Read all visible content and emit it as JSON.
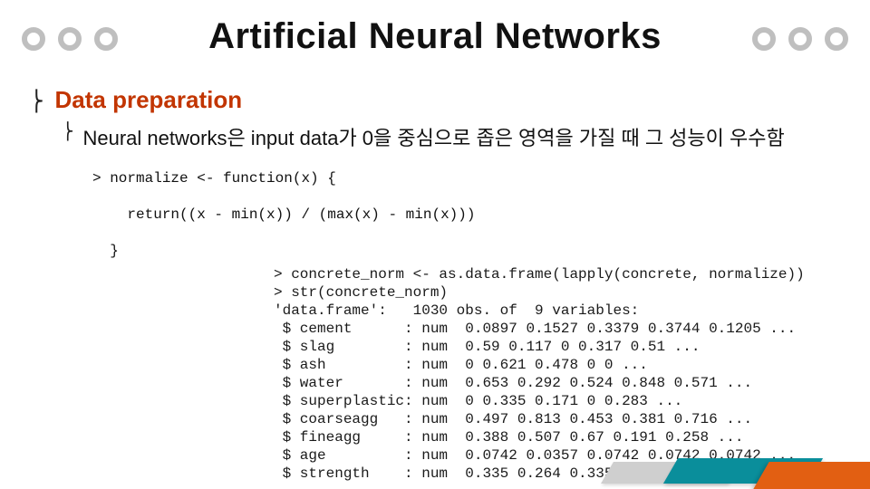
{
  "title": "Artificial Neural Networks",
  "section_heading": "Data preparation",
  "subpoint": "Neural networks은 input data가 0을 중심으로 좁은 영역을 가질 때 그 성능이 우수함",
  "code_block": "> normalize <- function(x) {\n\n    return((x - min(x)) / (max(x) - min(x)))\n\n  }",
  "r_output_intro": "> concrete_norm <- as.data.frame(lapply(concrete, normalize))\n> str(concrete_norm)\n'data.frame':   1030 obs. of  9 variables:",
  "r_vars": [
    {
      "name": "cement",
      "type": "num",
      "values": "0.0897 0.1527 0.3379 0.3744 0.1205 ..."
    },
    {
      "name": "slag",
      "type": "num",
      "values": "0.59 0.117 0 0.317 0.51 ..."
    },
    {
      "name": "ash",
      "type": "num",
      "values": "0 0.621 0.478 0 0 ..."
    },
    {
      "name": "water",
      "type": "num",
      "values": "0.653 0.292 0.524 0.848 0.571 ..."
    },
    {
      "name": "superplastic",
      "type": "num",
      "values": "0 0.335 0.171 0 0.283 ..."
    },
    {
      "name": "coarseagg",
      "type": "num",
      "values": "0.497 0.813 0.453 0.381 0.716 ..."
    },
    {
      "name": "fineagg",
      "type": "num",
      "values": "0.388 0.507 0.67 0.191 0.258 ..."
    },
    {
      "name": "age",
      "type": "num",
      "values": "0.0742 0.0357 0.0742 0.0742 0.0742 ..."
    },
    {
      "name": "strength",
      "type": "num",
      "values": "0.335 0.264 0.335 0.542 0.199 ..."
    }
  ]
}
